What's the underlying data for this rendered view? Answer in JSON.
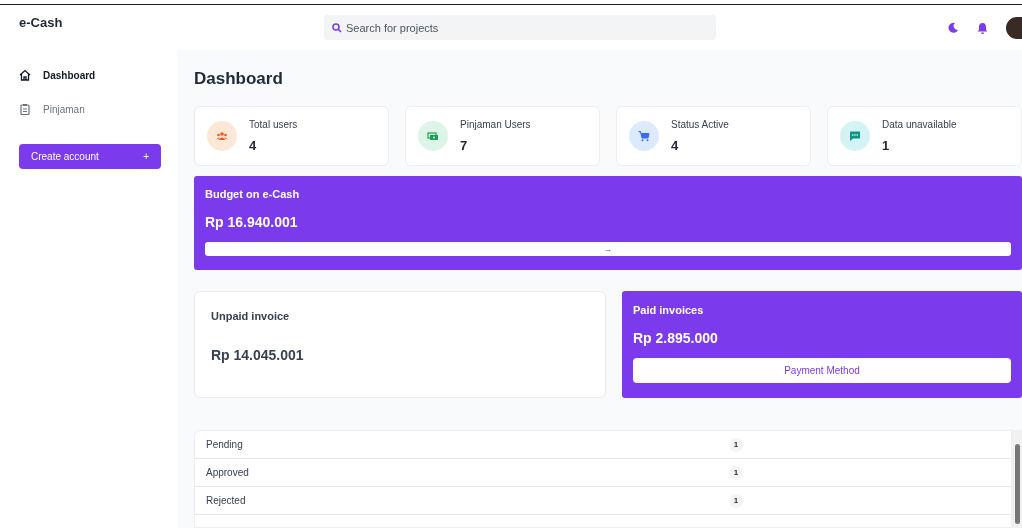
{
  "brand": "e-Cash",
  "search": {
    "placeholder": "Search for projects"
  },
  "sidebar": {
    "items": [
      {
        "label": "Dashboard",
        "kind": "home",
        "selected": true
      },
      {
        "label": "Pinjaman",
        "kind": "clipboard",
        "selected": false
      }
    ],
    "create_button": {
      "label": "Create account",
      "icon": "+"
    }
  },
  "page_title": "Dashboard",
  "stats": [
    {
      "label": "Total users",
      "value": "4",
      "kind": "users",
      "color": "#fde7d6"
    },
    {
      "label": "Pinjaman Users",
      "value": "7",
      "kind": "cash",
      "color": "#dcf5e8"
    },
    {
      "label": "Status Active",
      "value": "4",
      "kind": "cart",
      "color": "#dde9fd"
    },
    {
      "label": "Data unavailable",
      "value": "1",
      "kind": "chat",
      "color": "#d4f3f4"
    }
  ],
  "budget": {
    "title": "Budget on e-Cash",
    "amount": "Rp 16.940.001",
    "button": "→"
  },
  "unpaid": {
    "title": "Unpaid invoice",
    "amount": "Rp 14.045.001"
  },
  "paid": {
    "title": "Paid invoices",
    "amount": "Rp 2.895.000",
    "button": "Payment Method"
  },
  "statuses": [
    {
      "label": "Pending",
      "count": "1"
    },
    {
      "label": "Approved",
      "count": "1"
    },
    {
      "label": "Rejected",
      "count": "1"
    }
  ]
}
